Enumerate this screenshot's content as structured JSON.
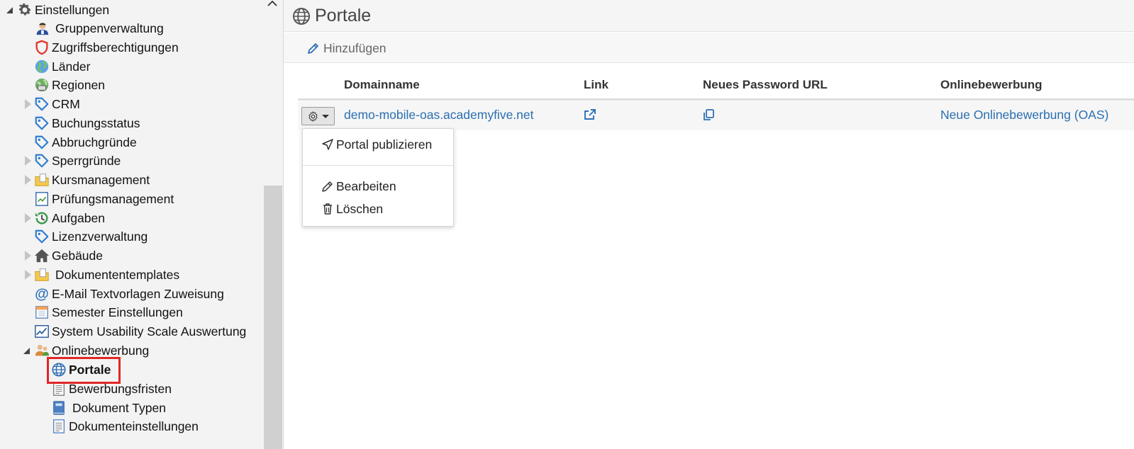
{
  "sidebar": {
    "items": [
      {
        "label": "Einstellungen",
        "icon": "gear-icon"
      },
      {
        "label": "Gruppenverwaltung",
        "icon": "user-group-icon"
      },
      {
        "label": "Zugriffsberechtigungen",
        "icon": "shield-icon"
      },
      {
        "label": "Länder",
        "icon": "globe-icon"
      },
      {
        "label": "Regionen",
        "icon": "globe-region-icon"
      },
      {
        "label": "CRM",
        "icon": "tag-icon"
      },
      {
        "label": "Buchungsstatus",
        "icon": "tag-icon"
      },
      {
        "label": "Abbruchgründe",
        "icon": "tag-icon"
      },
      {
        "label": "Sperrgründe",
        "icon": "tag-icon"
      },
      {
        "label": "Kursmanagement",
        "icon": "folder-icon"
      },
      {
        "label": "Prüfungsmanagement",
        "icon": "chart-doc-icon"
      },
      {
        "label": "Aufgaben",
        "icon": "history-icon"
      },
      {
        "label": "Lizenzverwaltung",
        "icon": "tag-icon"
      },
      {
        "label": "Gebäude",
        "icon": "house-icon"
      },
      {
        "label": "Dokumententemplates",
        "icon": "folder-icon"
      },
      {
        "label": "E-Mail Textvorlagen Zuweisung",
        "icon": "at-icon"
      },
      {
        "label": "Semester Einstellungen",
        "icon": "calendar-icon"
      },
      {
        "label": "System Usability Scale Auswertung",
        "icon": "line-chart-icon"
      },
      {
        "label": "Onlinebewerbung",
        "icon": "users-icon"
      },
      {
        "label": "Portale",
        "icon": "globe-outline-icon"
      },
      {
        "label": "Bewerbungsfristen",
        "icon": "list-doc-icon"
      },
      {
        "label": "Dokument Typen",
        "icon": "book-icon"
      },
      {
        "label": "Dokumenteinstellungen",
        "icon": "list-doc-icon"
      }
    ]
  },
  "main": {
    "title": "Portale",
    "toolbar": {
      "add_label": "Hinzufügen"
    },
    "grid": {
      "columns": [
        "Domainname",
        "Link",
        "Neues Password URL",
        "Onlinebewerbung"
      ],
      "rows": [
        {
          "domain": "demo-mobile-oas.academyfive.net",
          "onlinebewerbung": "Neue Onlinebewerbung (OAS)"
        }
      ]
    },
    "menu": {
      "publish": "Portal publizieren",
      "edit": "Bearbeiten",
      "delete": "Löschen"
    }
  },
  "colors": {
    "link": "#2a6fb0",
    "highlight": "#e32626",
    "tag": "#2f7dd1"
  }
}
